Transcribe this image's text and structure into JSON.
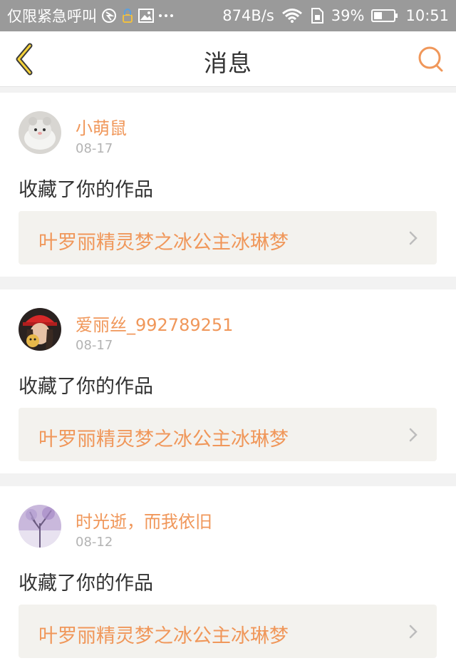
{
  "status_bar": {
    "carrier": "仅限紧急呼叫",
    "speed": "874B/s",
    "battery": "39%",
    "time": "10:51",
    "icons": [
      "no-signal-icon",
      "vpn-lock-icon",
      "image-icon",
      "more-dots-icon",
      "wifi-icon",
      "sim-icon",
      "battery-icon"
    ]
  },
  "nav": {
    "title": "消息",
    "back_icon": "chevron-left-icon",
    "search_icon": "search-icon",
    "accent": "#f0975a"
  },
  "messages": [
    {
      "user": "小萌鼠",
      "date": "08-17",
      "action": "收藏了你的作品",
      "work_title": "叶罗丽精灵梦之冰公主冰琳梦",
      "avatar": "hamster-plush-avatar"
    },
    {
      "user": "爱丽丝_992789251",
      "date": "08-17",
      "action": "收藏了你的作品",
      "work_title": "叶罗丽精灵梦之冰公主冰琳梦",
      "avatar": "girl-red-hat-avatar"
    },
    {
      "user": "时光逝，而我依旧",
      "date": "08-12",
      "action": "收藏了你的作品",
      "work_title": "叶罗丽精灵梦之冰公主冰琳梦",
      "avatar": "purple-tree-avatar"
    }
  ]
}
